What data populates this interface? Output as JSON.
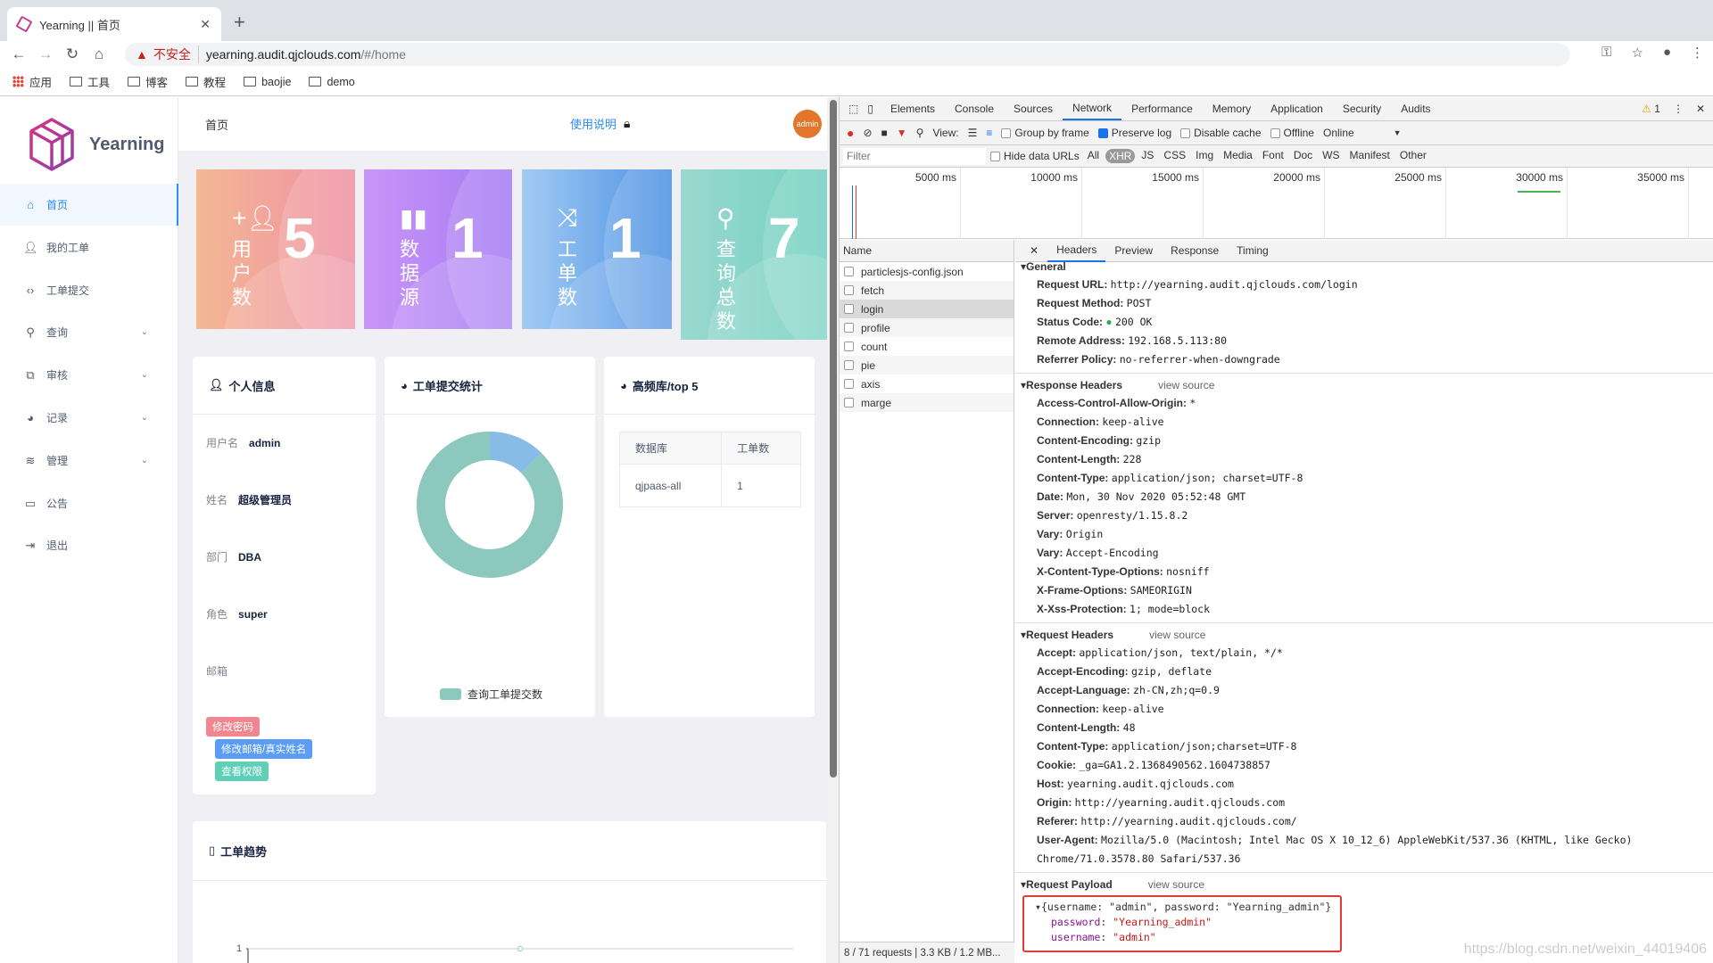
{
  "browser": {
    "tab_title": "Yearning || 首页",
    "insecure_label": "不安全",
    "url_host": "yearning.audit.qjclouds.com",
    "url_path": "/#/home",
    "bookmarks": [
      "应用",
      "工具",
      "博客",
      "教程",
      "baojie",
      "demo"
    ]
  },
  "sidebar": {
    "logo_text": "Yearning",
    "items": [
      {
        "label": "首页",
        "icon": "home-icon",
        "active": true
      },
      {
        "label": "我的工单",
        "icon": "user-icon"
      },
      {
        "label": "工单提交",
        "icon": "code-icon"
      },
      {
        "label": "查询",
        "icon": "search-icon",
        "expandable": true
      },
      {
        "label": "审核",
        "icon": "external-edit-icon",
        "expandable": true
      },
      {
        "label": "记录",
        "icon": "pie-chart-icon",
        "expandable": true
      },
      {
        "label": "管理",
        "icon": "layers-icon",
        "expandable": true
      },
      {
        "label": "公告",
        "icon": "clipboard-icon"
      },
      {
        "label": "退出",
        "icon": "logout-icon"
      }
    ]
  },
  "header": {
    "breadcrumb": "首页",
    "help_link": "使用说明",
    "avatar": "admin"
  },
  "stats": [
    {
      "label": "用户数",
      "value": "5",
      "icon": "user-add-icon",
      "colors": [
        "#f4b894",
        "#ee8fa4"
      ]
    },
    {
      "label": "数据源",
      "value": "1",
      "icon": "bar-chart-icon",
      "colors": [
        "#c995f7",
        "#a47af4"
      ]
    },
    {
      "label": "工单数",
      "value": "1",
      "icon": "shuffle-icon",
      "colors": [
        "#a2cbf4",
        "#4a90e2"
      ]
    },
    {
      "label": "查询总数",
      "value": "7",
      "icon": "search-icon",
      "colors": [
        "#9ad8d0",
        "#72d1c0"
      ]
    }
  ],
  "profile": {
    "title": "个人信息",
    "fields": [
      {
        "label": "用户名",
        "value": "admin"
      },
      {
        "label": "姓名",
        "value": "超级管理员"
      },
      {
        "label": "部门",
        "value": "DBA"
      },
      {
        "label": "角色",
        "value": "super"
      },
      {
        "label": "邮箱",
        "value": ""
      }
    ],
    "buttons": [
      "修改密码",
      "修改邮箱/真实姓名",
      "查看权限"
    ]
  },
  "submit_stats": {
    "title": "工单提交统计"
  },
  "top5": {
    "title": "高频库/top 5",
    "columns": [
      "数据库",
      "工单数"
    ],
    "rows": [
      [
        "qjpaas-all",
        "1"
      ]
    ]
  },
  "trend": {
    "title": "工单趋势"
  },
  "chart_data": [
    {
      "type": "pie",
      "donut": true,
      "legend": [
        "查询工单提交数"
      ],
      "legend_placement": "bottom",
      "slices": [
        {
          "value": 7,
          "color": "#8cc8bd"
        },
        {
          "value": 1,
          "color": "#88bbe6"
        }
      ]
    },
    {
      "type": "line",
      "yticks": [
        "1"
      ],
      "series": [
        {
          "values": [
            1
          ],
          "color": "#8cc8bd"
        }
      ]
    }
  ],
  "devtools": {
    "tabs": [
      "Elements",
      "Console",
      "Sources",
      "Network",
      "Performance",
      "Memory",
      "Application",
      "Security",
      "Audits"
    ],
    "active_tab": "Network",
    "warnings": "1",
    "toolbar": {
      "view_label": "View:",
      "group_by_frame": "Group by frame",
      "preserve_log": "Preserve log",
      "disable_cache": "Disable cache",
      "offline": "Offline",
      "throttle": "Online"
    },
    "filter": {
      "placeholder": "Filter",
      "hide_data_urls": "Hide data URLs",
      "types": [
        "All",
        "XHR",
        "JS",
        "CSS",
        "Img",
        "Media",
        "Font",
        "Doc",
        "WS",
        "Manifest",
        "Other"
      ],
      "active_type": "XHR"
    },
    "timeline_ticks": [
      "5000 ms",
      "10000 ms",
      "15000 ms",
      "20000 ms",
      "25000 ms",
      "30000 ms",
      "35000 ms"
    ],
    "name_header": "Name",
    "requests": [
      "particlesjs-config.json",
      "fetch",
      "login",
      "profile",
      "count",
      "pie",
      "axis",
      "marge"
    ],
    "selected": "login",
    "status": "8 / 71 requests | 3.3 KB / 1.2 MB...",
    "detail_tabs": [
      "Headers",
      "Preview",
      "Response",
      "Timing"
    ],
    "view_source": "view source",
    "sections": [
      {
        "title": "General",
        "lines": [
          [
            "Request URL:",
            "http://yearning.audit.qjclouds.com/login"
          ],
          [
            "Request Method:",
            "POST"
          ],
          [
            "Status Code:",
            "200 OK"
          ],
          [
            "Remote Address:",
            "192.168.5.113:80"
          ],
          [
            "Referrer Policy:",
            "no-referrer-when-downgrade"
          ]
        ]
      },
      {
        "title": "Response Headers",
        "lines": [
          [
            "Access-Control-Allow-Origin:",
            "*"
          ],
          [
            "Connection:",
            "keep-alive"
          ],
          [
            "Content-Encoding:",
            "gzip"
          ],
          [
            "Content-Length:",
            "228"
          ],
          [
            "Content-Type:",
            "application/json; charset=UTF-8"
          ],
          [
            "Date:",
            "Mon, 30 Nov 2020 05:52:48 GMT"
          ],
          [
            "Server:",
            "openresty/1.15.8.2"
          ],
          [
            "Vary:",
            "Origin"
          ],
          [
            "Vary:",
            "Accept-Encoding"
          ],
          [
            "X-Content-Type-Options:",
            "nosniff"
          ],
          [
            "X-Frame-Options:",
            "SAMEORIGIN"
          ],
          [
            "X-Xss-Protection:",
            "1; mode=block"
          ]
        ]
      },
      {
        "title": "Request Headers",
        "lines": [
          [
            "Accept:",
            "application/json, text/plain, */*"
          ],
          [
            "Accept-Encoding:",
            "gzip, deflate"
          ],
          [
            "Accept-Language:",
            "zh-CN,zh;q=0.9"
          ],
          [
            "Connection:",
            "keep-alive"
          ],
          [
            "Content-Length:",
            "48"
          ],
          [
            "Content-Type:",
            "application/json;charset=UTF-8"
          ],
          [
            "Cookie:",
            "_ga=GA1.2.1368490562.1604738857"
          ],
          [
            "Host:",
            "yearning.audit.qjclouds.com"
          ],
          [
            "Origin:",
            "http://yearning.audit.qjclouds.com"
          ],
          [
            "Referer:",
            "http://yearning.audit.qjclouds.com/"
          ],
          [
            "User-Agent:",
            "Mozilla/5.0 (Macintosh; Intel Mac OS X 10_12_6) AppleWebKit/537.36 (KHTML, like Gecko) Chrome/71.0.3578.80 Safari/537.36"
          ]
        ]
      }
    ],
    "payload": {
      "title": "Request Payload",
      "summary": "{username: \"admin\", password: \"Yearning_admin\"}",
      "fields": [
        [
          "password",
          "\"Yearning_admin\""
        ],
        [
          "username",
          "\"admin\""
        ]
      ]
    },
    "watermark": "https://blog.csdn.net/weixin_44019406"
  }
}
